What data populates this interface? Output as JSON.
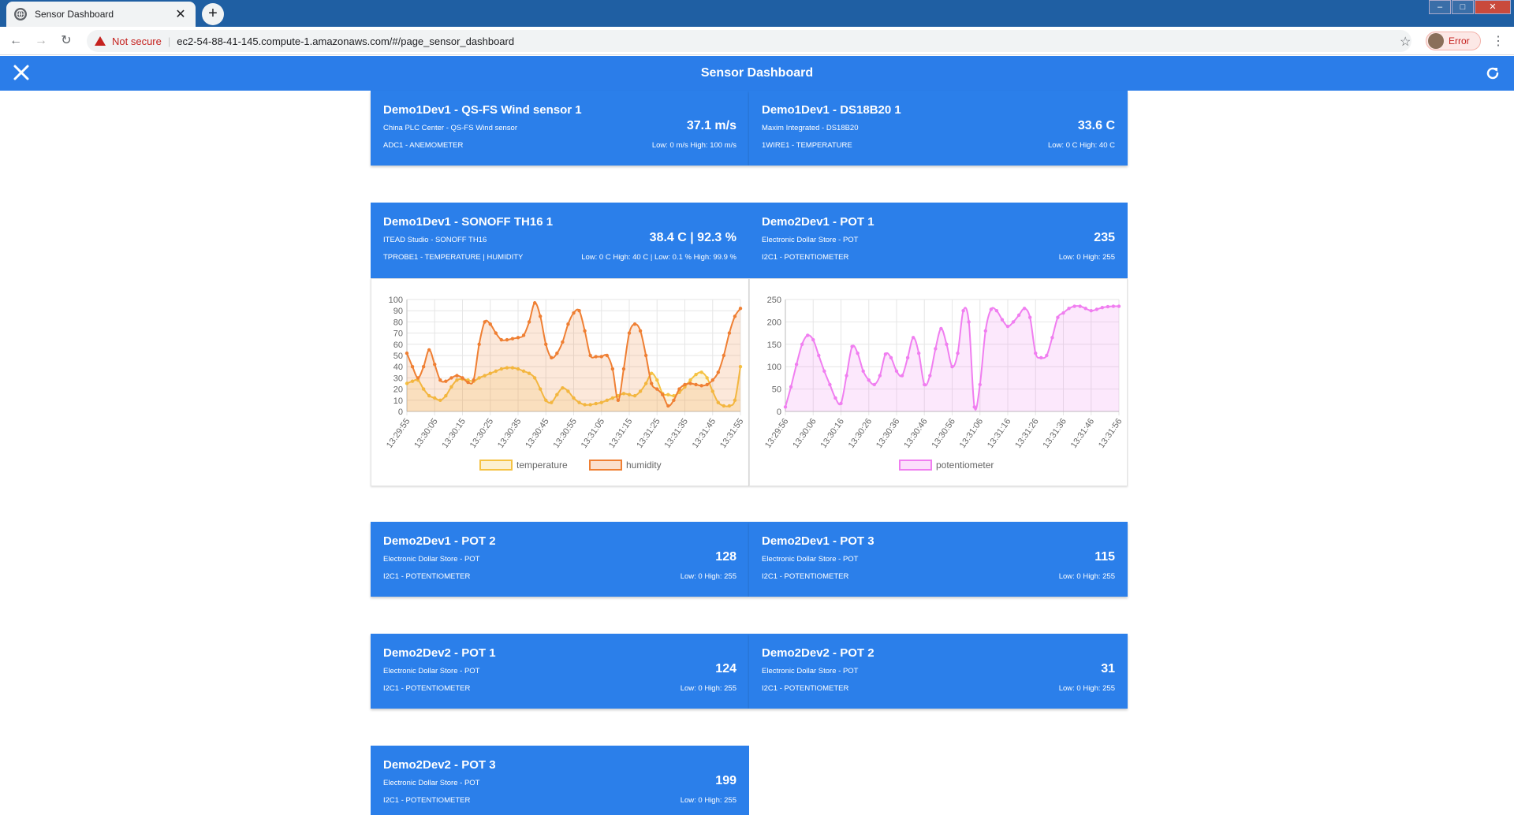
{
  "browser": {
    "tab_title": "Sensor Dashboard",
    "not_secure_label": "Not secure",
    "url": "ec2-54-88-41-145.compute-1.amazonaws.com/#/page_sensor_dashboard",
    "profile_label": "Error"
  },
  "app": {
    "title": "Sensor Dashboard"
  },
  "cards": [
    {
      "name": "Demo1Dev1 - QS-FS Wind sensor 1",
      "maker": "China PLC Center - QS-FS Wind sensor",
      "value": "37.1 m/s",
      "port": "ADC1 - ANEMOMETER",
      "range": "Low: 0 m/s High: 100 m/s"
    },
    {
      "name": "Demo1Dev1 - DS18B20 1",
      "maker": "Maxim Integrated - DS18B20",
      "value": "33.6 C",
      "port": "1WIRE1 - TEMPERATURE",
      "range": "Low: 0 C High: 40 C"
    },
    {
      "name": "Demo1Dev1 - SONOFF TH16 1",
      "maker": "ITEAD Studio - SONOFF TH16",
      "value": "38.4 C | 92.3 %",
      "port": "TPROBE1 - TEMPERATURE | HUMIDITY",
      "range": "Low: 0 C High: 40 C | Low: 0.1 % High: 99.9 %"
    },
    {
      "name": "Demo2Dev1 - POT 1",
      "maker": "Electronic Dollar Store - POT",
      "value": "235",
      "port": "I2C1 - POTENTIOMETER",
      "range": "Low: 0 High: 255"
    },
    {
      "name": "Demo2Dev1 - POT 2",
      "maker": "Electronic Dollar Store - POT",
      "value": "128",
      "port": "I2C1 - POTENTIOMETER",
      "range": "Low: 0 High: 255"
    },
    {
      "name": "Demo2Dev1 - POT 3",
      "maker": "Electronic Dollar Store - POT",
      "value": "115",
      "port": "I2C1 - POTENTIOMETER",
      "range": "Low: 0 High: 255"
    },
    {
      "name": "Demo2Dev2 - POT 1",
      "maker": "Electronic Dollar Store - POT",
      "value": "124",
      "port": "I2C1 - POTENTIOMETER",
      "range": "Low: 0 High: 255"
    },
    {
      "name": "Demo2Dev2 - POT 2",
      "maker": "Electronic Dollar Store - POT",
      "value": "31",
      "port": "I2C1 - POTENTIOMETER",
      "range": "Low: 0 High: 255"
    },
    {
      "name": "Demo2Dev2 - POT 3",
      "maker": "Electronic Dollar Store - POT",
      "value": "199",
      "port": "I2C1 - POTENTIOMETER",
      "range": "Low: 0 High: 255"
    }
  ],
  "chart_data": [
    {
      "type": "line",
      "x": [
        "13:29:55",
        "13:29:57",
        "13:29:59",
        "13:30:01",
        "13:30:03",
        "13:30:05",
        "13:30:07",
        "13:30:09",
        "13:30:11",
        "13:30:13",
        "13:30:15",
        "13:30:17",
        "13:30:19",
        "13:30:21",
        "13:30:23",
        "13:30:25",
        "13:30:27",
        "13:30:29",
        "13:30:31",
        "13:30:33",
        "13:30:35",
        "13:30:37",
        "13:30:39",
        "13:30:41",
        "13:30:43",
        "13:30:45",
        "13:30:47",
        "13:30:49",
        "13:30:51",
        "13:30:53",
        "13:30:55",
        "13:30:57",
        "13:30:59",
        "13:31:01",
        "13:31:03",
        "13:31:05",
        "13:31:07",
        "13:31:09",
        "13:31:11",
        "13:31:13",
        "13:31:15",
        "13:31:17",
        "13:31:19",
        "13:31:21",
        "13:31:23",
        "13:31:25",
        "13:31:27",
        "13:31:29",
        "13:31:31",
        "13:31:33",
        "13:31:35",
        "13:31:37",
        "13:31:39",
        "13:31:41",
        "13:31:43",
        "13:31:45",
        "13:31:47",
        "13:31:49",
        "13:31:51",
        "13:31:53",
        "13:31:55"
      ],
      "x_tick_labels": [
        "13:29:55",
        "13:30:05",
        "13:30:15",
        "13:30:25",
        "13:30:35",
        "13:30:45",
        "13:30:55",
        "13:31:05",
        "13:31:15",
        "13:31:25",
        "13:31:35",
        "13:31:45",
        "13:31:55"
      ],
      "series": [
        {
          "name": "temperature",
          "color": "#f5c242",
          "values": [
            25,
            27,
            28,
            20,
            14,
            12,
            10,
            14,
            22,
            28,
            29,
            28,
            27,
            30,
            32,
            34,
            36,
            38,
            39,
            39,
            38,
            36,
            34,
            30,
            20,
            10,
            8,
            15,
            21,
            18,
            12,
            8,
            6,
            6,
            7,
            8,
            10,
            12,
            14,
            16,
            15,
            14,
            18,
            25,
            34,
            28,
            16,
            15,
            14,
            17,
            22,
            28,
            33,
            35,
            30,
            18,
            8,
            5,
            5,
            10,
            40
          ]
        },
        {
          "name": "humidity",
          "color": "#ef7f33",
          "values": [
            52,
            40,
            30,
            40,
            55,
            42,
            28,
            27,
            30,
            32,
            30,
            26,
            28,
            60,
            80,
            78,
            70,
            64,
            64,
            65,
            66,
            68,
            80,
            97,
            85,
            60,
            48,
            52,
            62,
            78,
            88,
            90,
            72,
            50,
            49,
            49,
            50,
            38,
            10,
            38,
            70,
            78,
            72,
            50,
            25,
            20,
            15,
            5,
            10,
            20,
            24,
            25,
            24,
            23,
            24,
            28,
            35,
            50,
            70,
            85,
            92
          ]
        }
      ],
      "ylim": [
        0,
        100
      ],
      "yticks": [
        0,
        10,
        20,
        30,
        40,
        50,
        60,
        70,
        80,
        90,
        100
      ]
    },
    {
      "type": "area",
      "x": [
        "13:29:56",
        "13:29:58",
        "13:30:00",
        "13:30:02",
        "13:30:04",
        "13:30:06",
        "13:30:08",
        "13:30:10",
        "13:30:12",
        "13:30:14",
        "13:30:16",
        "13:30:18",
        "13:30:20",
        "13:30:22",
        "13:30:24",
        "13:30:26",
        "13:30:28",
        "13:30:30",
        "13:30:32",
        "13:30:34",
        "13:30:36",
        "13:30:38",
        "13:30:40",
        "13:30:42",
        "13:30:44",
        "13:30:46",
        "13:30:48",
        "13:30:50",
        "13:30:52",
        "13:30:54",
        "13:30:56",
        "13:30:58",
        "13:31:00",
        "13:31:02",
        "13:31:04",
        "13:31:06",
        "13:31:08",
        "13:31:10",
        "13:31:12",
        "13:31:14",
        "13:31:16",
        "13:31:18",
        "13:31:20",
        "13:31:22",
        "13:31:24",
        "13:31:26",
        "13:31:28",
        "13:31:30",
        "13:31:32",
        "13:31:34",
        "13:31:36",
        "13:31:38",
        "13:31:40",
        "13:31:42",
        "13:31:44",
        "13:31:46",
        "13:31:48",
        "13:31:50",
        "13:31:52",
        "13:31:54",
        "13:31:56"
      ],
      "x_tick_labels": [
        "13:29:56",
        "13:30:06",
        "13:30:16",
        "13:30:26",
        "13:30:36",
        "13:30:46",
        "13:30:56",
        "13:31:06",
        "13:31:16",
        "13:31:26",
        "13:31:36",
        "13:31:46",
        "13:31:56"
      ],
      "series": [
        {
          "name": "potentiometer",
          "color": "#f07ef0",
          "values": [
            10,
            55,
            105,
            150,
            170,
            160,
            125,
            90,
            60,
            30,
            18,
            80,
            145,
            130,
            90,
            70,
            60,
            80,
            128,
            120,
            90,
            80,
            120,
            165,
            130,
            60,
            80,
            140,
            185,
            150,
            100,
            130,
            225,
            200,
            10,
            60,
            180,
            228,
            225,
            205,
            190,
            200,
            215,
            230,
            210,
            130,
            120,
            125,
            165,
            210,
            220,
            230,
            235,
            235,
            230,
            225,
            228,
            232,
            234,
            235,
            235
          ]
        }
      ],
      "ylim": [
        0,
        250
      ],
      "yticks": [
        0,
        50,
        100,
        150,
        200,
        250
      ]
    }
  ]
}
